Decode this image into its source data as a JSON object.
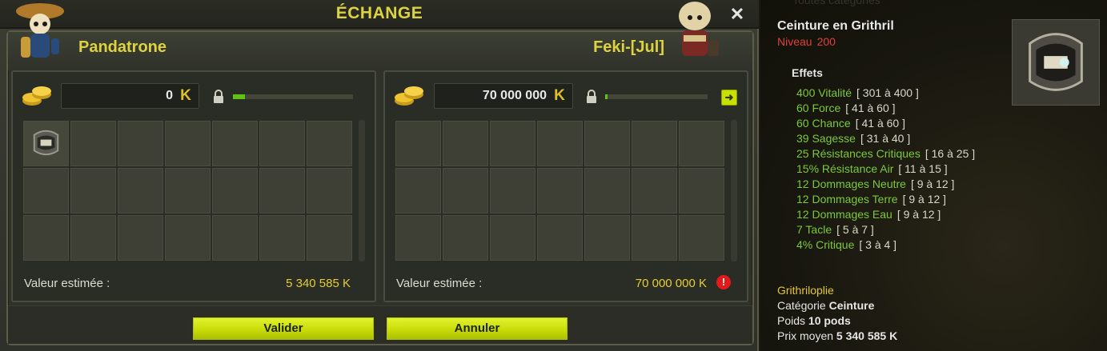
{
  "window": {
    "title": "ÉCHANGE"
  },
  "players": {
    "left_name": "Pandatrone",
    "right_name": "Feki-[Jul]"
  },
  "left_panel": {
    "kamas": "0",
    "value_label": "Valeur estimée :",
    "value_amount": "5 340 585 K",
    "progress": 0.1
  },
  "right_panel": {
    "kamas": "70 000 000",
    "value_label": "Valeur estimée :",
    "value_amount": "70 000 000 K",
    "progress": 0.02,
    "warning_icon": "!"
  },
  "buttons": {
    "validate": "Valider",
    "cancel": "Annuler"
  },
  "detail": {
    "background_text": "Toutes catégories",
    "item_name": "Ceinture en Grithril",
    "level_label": "Niveau",
    "level_value": "200",
    "effects_title": "Effets",
    "effects": [
      {
        "text": "400 Vitalité",
        "range": "[ 301 à 400 ]"
      },
      {
        "text": "60 Force",
        "range": "[ 41 à 60 ]"
      },
      {
        "text": "60 Chance",
        "range": "[ 41 à 60 ]"
      },
      {
        "text": "39 Sagesse",
        "range": "[ 31 à 40 ]"
      },
      {
        "text": "25 Résistances Critiques",
        "range": "[ 16 à 25 ]"
      },
      {
        "text": "15% Résistance Air",
        "range": "[ 11 à 15 ]"
      },
      {
        "text": "12 Dommages Neutre",
        "range": "[ 9 à 12 ]"
      },
      {
        "text": "12 Dommages Terre",
        "range": "[ 9 à 12 ]"
      },
      {
        "text": "12 Dommages Eau",
        "range": "[ 9 à 12 ]"
      },
      {
        "text": "7 Tacle",
        "range": "[ 5 à 7 ]"
      },
      {
        "text": "4% Critique",
        "range": "[ 3 à 4 ]"
      }
    ],
    "set_name": "Grithriloplie",
    "category_label": "Catégorie",
    "category_value": "Ceinture",
    "weight_label": "Poids",
    "weight_value": "10 pods",
    "price_label": "Prix moyen",
    "price_value": "5 340 585 K"
  },
  "icons": {
    "close": "close-icon",
    "coins": "gold-coins-icon",
    "kamas": "kamas-icon",
    "lock": "lock-icon",
    "accept": "accept-arrow-icon",
    "warning": "warning-icon",
    "belt_item": "belt-item-icon"
  },
  "colors": {
    "title": "#ddd340",
    "button": "#c8dc08",
    "effect": "#7cc83a",
    "level": "#e0403c",
    "set": "#e6c634",
    "progress": "#62c214",
    "warning": "#e41a1a"
  }
}
